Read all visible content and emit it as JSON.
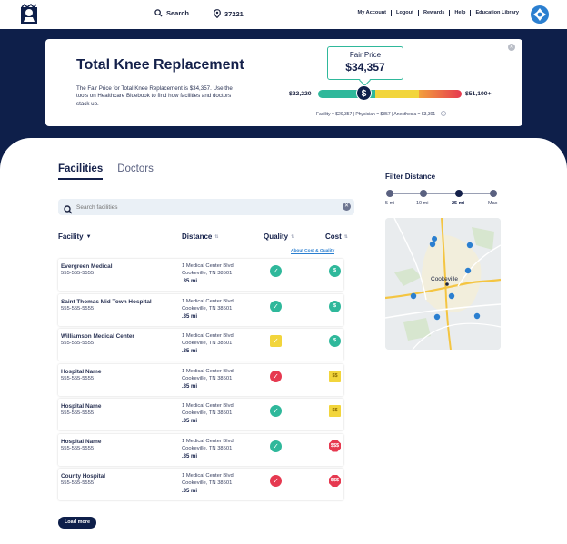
{
  "nav": {
    "search_label": "Search",
    "zip": "37221",
    "links": [
      "My Account",
      "Logout",
      "Rewards",
      "Help",
      "Education Library"
    ]
  },
  "hero": {
    "title": "Total Knee Replacement",
    "description": "The Fair Price for Total Knee Replacement is $34,357. Use the tools on Healthcare Bluebook to find how facilities and doctors stack up.",
    "fair_price_label": "Fair Price",
    "fair_price_value": "$34,357",
    "price_low": "$22,220",
    "price_high": "$51,100+",
    "marker_symbol": "$",
    "breakdown": "Facility = $29,357  |  Physician = $857  |  Anesthesia = $3,301",
    "fair_price_position": 0.33
  },
  "tabs": [
    {
      "label": "Facilities",
      "active": true
    },
    {
      "label": "Doctors",
      "active": false
    }
  ],
  "search": {
    "placeholder": "Search facilities"
  },
  "table": {
    "headers": {
      "facility": "Facility",
      "distance": "Distance",
      "quality": "Quality",
      "cost": "Cost"
    },
    "about_link": "About Cost & Quality",
    "rows": [
      {
        "name": "Evergreen Medical",
        "phone": "555-555-5555",
        "addr1": "1 Medical Center Blvd",
        "addr2": "Cookeville, TN 38501",
        "distance": ".35 mi",
        "quality": "good",
        "cost": "$",
        "cost_level": "low"
      },
      {
        "name": "Saint Thomas Mid Town Hospital",
        "phone": "555-555-5555",
        "addr1": "1 Medical Center Blvd",
        "addr2": "Cookeville, TN 38501",
        "distance": ".35 mi",
        "quality": "good",
        "cost": "$",
        "cost_level": "low"
      },
      {
        "name": "Williamson Medical Center",
        "phone": "555-555-5555",
        "addr1": "1 Medical Center Blvd",
        "addr2": "Cookeville, TN 38501",
        "distance": ".35 mi",
        "quality": "avg",
        "cost": "$",
        "cost_level": "low"
      },
      {
        "name": "Hospital Name",
        "phone": "555-555-5555",
        "addr1": "1 Medical Center Blvd",
        "addr2": "Cookeville, TN 38501",
        "distance": ".35 mi",
        "quality": "bad",
        "cost": "$$",
        "cost_level": "mid"
      },
      {
        "name": "Hospital Name",
        "phone": "555-555-5555",
        "addr1": "1 Medical Center Blvd",
        "addr2": "Cookeville, TN 38501",
        "distance": ".35 mi",
        "quality": "good",
        "cost": "$$",
        "cost_level": "mid"
      },
      {
        "name": "Hospital Name",
        "phone": "555-555-5555",
        "addr1": "1 Medical Center Blvd",
        "addr2": "Cookeville, TN 38501",
        "distance": ".35 mi",
        "quality": "good",
        "cost": "$$$",
        "cost_level": "high"
      },
      {
        "name": "County Hospital",
        "phone": "555-555-5555",
        "addr1": "1 Medical Center Blvd",
        "addr2": "Cookeville, TN 38501",
        "distance": ".35 mi",
        "quality": "bad",
        "cost": "$$$",
        "cost_level": "high"
      }
    ]
  },
  "load_more": "Load more",
  "filter": {
    "title": "Filter Distance",
    "stops": [
      "5 mi",
      "10 mi",
      "25 mi",
      "Max"
    ],
    "selected_index": 2
  },
  "map": {
    "city_label": "Cookeville"
  },
  "colors": {
    "navy": "#0e1f4a",
    "green": "#2fb89b",
    "yellow": "#f2d53c",
    "red": "#e63950",
    "link": "#2b7fd0"
  }
}
